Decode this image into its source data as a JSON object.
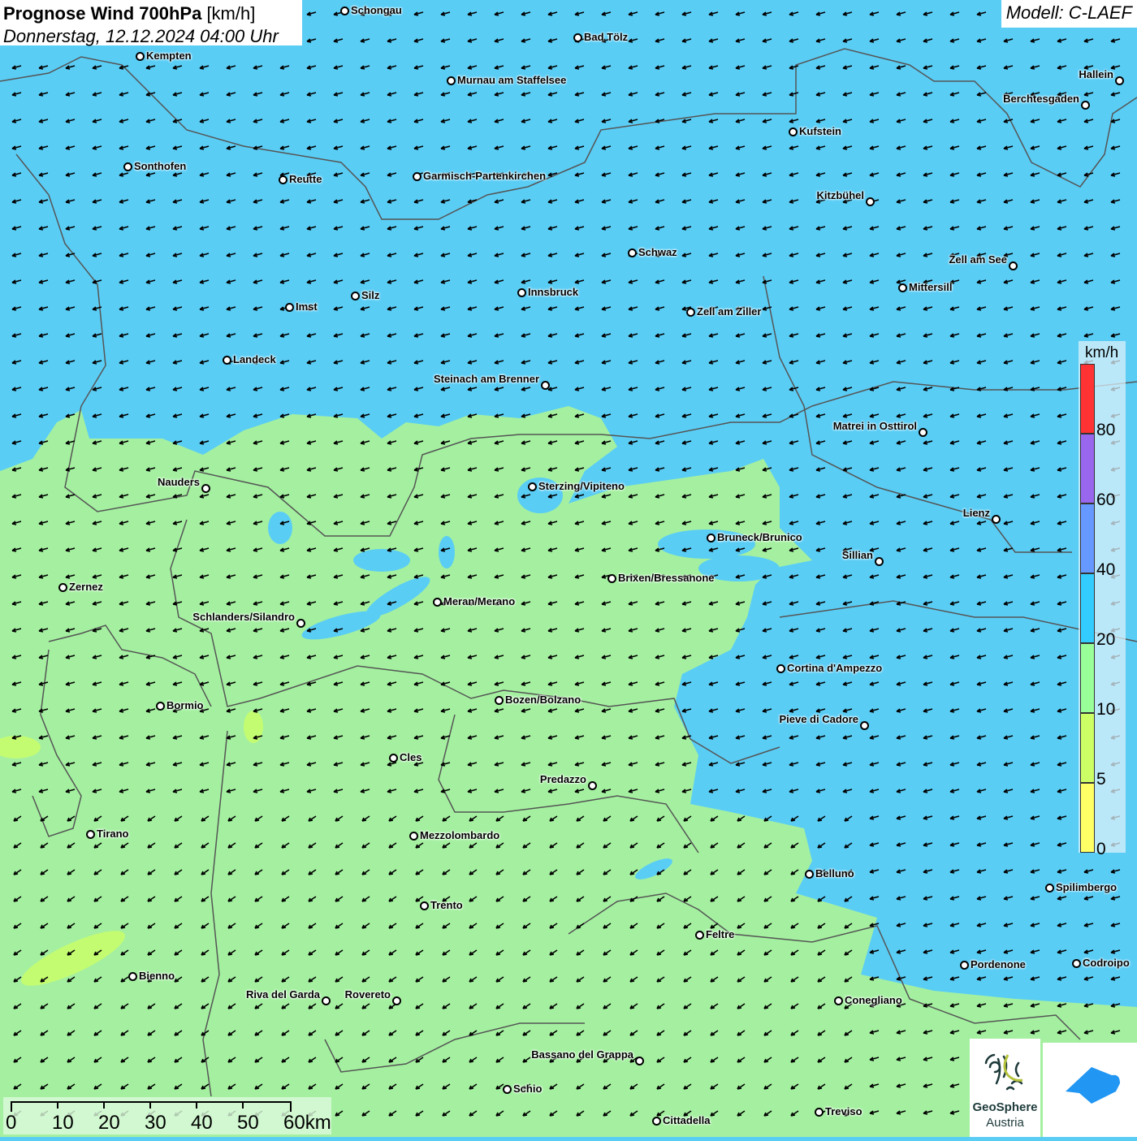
{
  "header": {
    "title_bold": "Prognose Wind 700hPa",
    "title_unit": "[km/h]",
    "datetime": "Donnerstag, 12.12.2024 04:00 Uhr",
    "model": "Modell: C-LAEF"
  },
  "legend": {
    "unit": "km/h",
    "labels": [
      "80",
      "60",
      "40",
      "20",
      "10",
      "5",
      "0"
    ],
    "colors": [
      "#ff3333",
      "#9966ee",
      "#6699ff",
      "#33ccff",
      "#99ff99",
      "#ccff66",
      "#ffff66"
    ]
  },
  "scale_bar": {
    "labels": [
      "0",
      "10",
      "20",
      "30",
      "40",
      "50",
      "60km"
    ]
  },
  "logos": {
    "geosphere_line1": "GeoSphere",
    "geosphere_line2": "Austria"
  },
  "map_colors": {
    "blue_20_40": "#5acdf5",
    "green_10_20": "#a4f0a0"
  },
  "cities": [
    "Schongau",
    "Bad Tölz",
    "Kempten",
    "Murnau am Staffelsee",
    "Hallein",
    "Berchtesgaden",
    "Kufstein",
    "Sonthofen",
    "Reutte",
    "Garmisch-Partenkirchen",
    "Kitzbühel",
    "Schwaz",
    "Zell am See",
    "Innsbruck",
    "Mittersill",
    "Imst",
    "Silz",
    "Zell am Ziller",
    "Landeck",
    "Steinach am Brenner",
    "Matrei in Osttirol",
    "Nauders",
    "Sterzing/Vipiteno",
    "Lienz",
    "Bruneck/Brunico",
    "Sillian",
    "Brixen/Bressanone",
    "Zernez",
    "Meran/Merano",
    "Schlanders/Silandro",
    "Cortina d'Ampezzo",
    "Bozen/Bolzano",
    "Bormio",
    "Pieve di Cadore",
    "Cles",
    "Predazzo",
    "Tirano",
    "Mezzolombardo",
    "Belluno",
    "Spilimbergo",
    "Trento",
    "Feltre",
    "Pordenone",
    "Codroipo",
    "Bienno",
    "Riva del Garda",
    "Rovereto",
    "Conegliano",
    "Bassano del Grappa",
    "Schio",
    "Treviso",
    "Cittadella"
  ]
}
